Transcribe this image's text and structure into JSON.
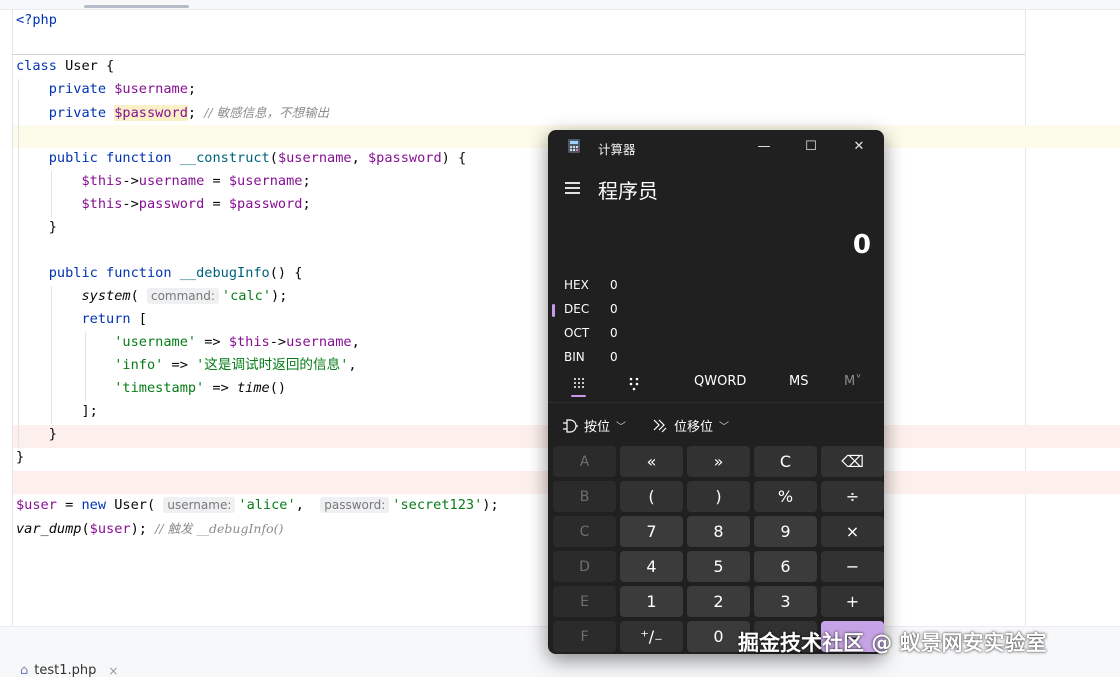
{
  "editor": {
    "file_tab": "test1.php",
    "lines": {
      "php_open": "<?php",
      "class_kw": "class",
      "class_name": " User {",
      "private1_kw": "private",
      "private1_var": "$username",
      "private1_end": ";",
      "private2_kw": "private",
      "private2_var": "$password",
      "private2_end": ";",
      "private2_cmt": "// 敏感信息，不想输出",
      "construct_kw1": "public",
      "construct_kw2": "function",
      "construct_name": "__construct",
      "construct_p1": "$username",
      "construct_p2": "$password",
      "this1": "$this",
      "this1_prop": "username",
      "this1_rhs": "$username",
      "this2": "$this",
      "this2_prop": "password",
      "this2_rhs": "$password",
      "close_brace": "}",
      "debug_kw1": "public",
      "debug_kw2": "function",
      "debug_name": "__debugInfo",
      "system_fn": "system",
      "system_hint": "command:",
      "system_arg": "'calc'",
      "return_kw": "return",
      "arr_k1": "'username'",
      "arr_this": "$this",
      "arr_prop": "username",
      "arr_k2": "'info'",
      "arr_v2": "'这是调试时返回的信息'",
      "arr_k3": "'timestamp'",
      "arr_fn3": "time",
      "arr_end": "];",
      "user_var": "$user",
      "new_kw": "new",
      "new_class": "User(",
      "hint_user": "username:",
      "arg_user": "'alice'",
      "hint_pass": "password:",
      "arg_pass": "'secret123'",
      "dump_fn": "var_dump",
      "dump_arg": "$user",
      "dump_cmt": "// 触发 __debugInfo()"
    }
  },
  "calculator": {
    "title": "计算器",
    "mode": "程序员",
    "display_value": "0",
    "radix": [
      {
        "label": "HEX",
        "value": "0"
      },
      {
        "label": "DEC",
        "value": "0"
      },
      {
        "label": "OCT",
        "value": "0"
      },
      {
        "label": "BIN",
        "value": "0"
      }
    ],
    "word_size": "QWORD",
    "ms": "MS",
    "m_dropdown": "M˅",
    "bitwise": "按位",
    "bitshift": "位移位",
    "keys": [
      [
        "A",
        "«",
        "»",
        "C",
        "⌫"
      ],
      [
        "B",
        "(",
        ")",
        "%",
        "÷"
      ],
      [
        "C",
        "7",
        "8",
        "9",
        "×"
      ],
      [
        "D",
        "4",
        "5",
        "6",
        "−"
      ],
      [
        "E",
        "1",
        "2",
        "3",
        "+"
      ],
      [
        "F",
        "⁺/₋",
        "0",
        ".",
        "="
      ]
    ]
  },
  "watermark": "掘金技术社区 @ 蚁景网安实验室"
}
